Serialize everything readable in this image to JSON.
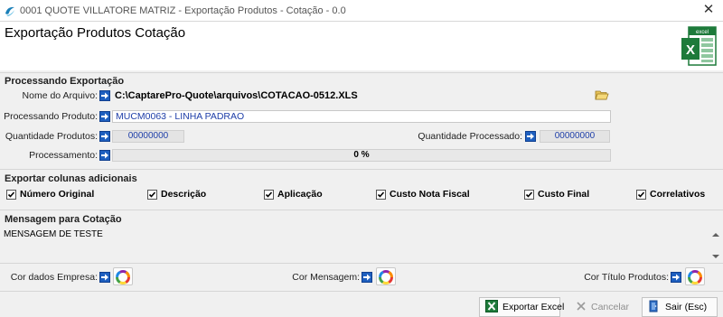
{
  "window": {
    "title": "0001 QUOTE VILLATORE MATRIZ - Exportação Produtos - Cotação - 0.0",
    "close_glyph": "✕"
  },
  "header": {
    "heading": "Exportação Produtos Cotação",
    "logo_text": "excel",
    "logo_letter": "X"
  },
  "processing": {
    "section_title": "Processando Exportação",
    "file_name_label": "Nome do Arquivo:",
    "file_name_value": "C:\\CaptarePro-Quote\\arquivos\\COTACAO-0512.XLS",
    "product_label": "Processando Produto:",
    "product_value": "MUCM0063 - LINHA PADRAO",
    "qty_products_label": "Quantidade Produtos:",
    "qty_products_value": "00000000",
    "qty_processed_label": "Quantidade Processado:",
    "qty_processed_value": "00000000",
    "progress_label": "Processamento:",
    "progress_text": "0 %",
    "progress_fraction": 0
  },
  "columns": {
    "section_title": "Exportar colunas adicionais",
    "options": [
      {
        "label": "Número Original",
        "checked": true
      },
      {
        "label": "Descrição",
        "checked": true
      },
      {
        "label": "Aplicação",
        "checked": true
      },
      {
        "label": "Custo Nota Fiscal",
        "checked": true
      },
      {
        "label": "Custo Final",
        "checked": true
      },
      {
        "label": "Correlativos",
        "checked": true
      }
    ]
  },
  "message": {
    "section_title": "Mensagem para Cotação",
    "text": "MENSAGEM DE TESTE"
  },
  "colors": {
    "company_label": "Cor dados Empresa:",
    "message_label": "Cor Mensagem:",
    "product_title_label": "Cor Título Produtos:"
  },
  "buttons": {
    "export_excel": "Exportar Excel",
    "cancel": "Cancelar",
    "exit": "Sair (Esc)"
  },
  "theme": {
    "accent_blue": "#1e5fbf",
    "value_blue": "#1e3ea8",
    "excel_green": "#1d7a3a"
  }
}
